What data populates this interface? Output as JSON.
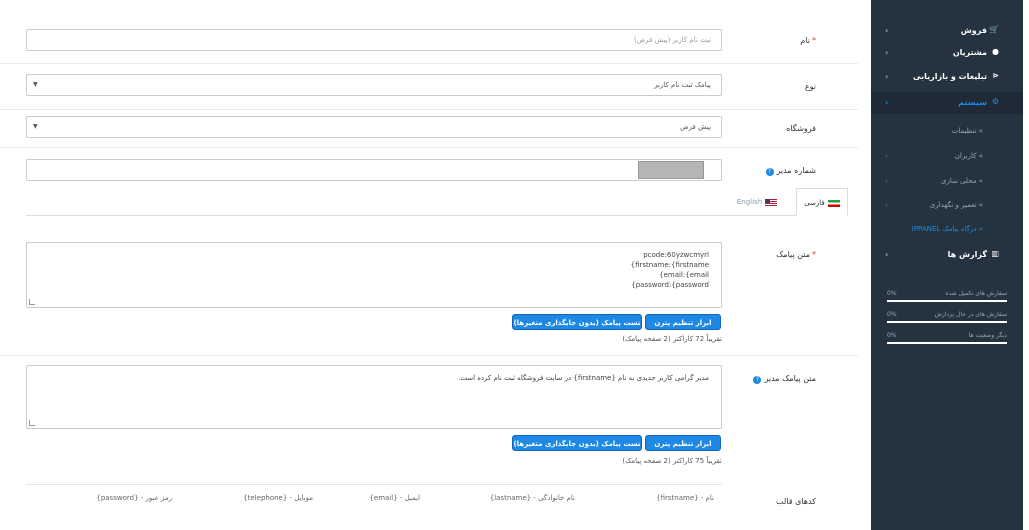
{
  "form": {
    "name": {
      "label": "نام",
      "value": "ثبت نام کاربر (پیش فرض)"
    },
    "type": {
      "label": "نوع",
      "value": "پیامک ثبت نام کاربر"
    },
    "store": {
      "label": "فروشگاه",
      "value": "پیش فرض"
    },
    "admin_number": {
      "label": "شماره مدیر"
    },
    "tabs": [
      {
        "label": "فارسی",
        "flag": "iran-flag-icon"
      },
      {
        "label": "English",
        "flag": "uk-flag-icon"
      }
    ],
    "message": {
      "label": "متن پیامک",
      "lines": [
        "pcode:60yzwcmyrl",
        "{firstname:{firstname",
        "{email:{email",
        "{password:{password"
      ],
      "btn_pattern": "ابزار تنظیم پترن",
      "btn_test": "تست پیامک (بدون جایگذاری متغیرها)",
      "count": "تقریباً 72 کاراکتر (2 صفحه پیامک)"
    },
    "admin_message": {
      "label": "متن پیامک مدیر",
      "text": "مدیر گرامی کاربر جدیدی به نام {firstname} در سایت فروشگاه ثبت نام کرده است.",
      "btn_pattern": "ابزار تنظیم پترن",
      "btn_test": "تست پیامک (بدون جایگذاری متغیرها)",
      "count": "تقریباً 75 کاراکتر (2 صفحه پیامک)"
    },
    "template_codes": {
      "label": "کدهای قالب",
      "items": [
        "نام - {firstname}",
        "نام خانوادگی - {lastname}",
        "ایمیل - {email}",
        "موبایل - {telephone}",
        "رمز عبور - {password}"
      ]
    }
  },
  "sidebar": {
    "items": [
      {
        "label": "فروش",
        "icon": "cart-icon"
      },
      {
        "label": "مشتریان",
        "icon": "user-icon"
      },
      {
        "label": "تبلیغات و بازاریابی",
        "icon": "share-icon"
      },
      {
        "label": "سیستم",
        "icon": "gear-icon"
      }
    ],
    "sub_items": [
      {
        "label": "تنظیمات"
      },
      {
        "label": "کاربران"
      },
      {
        "label": "محلی سازی"
      },
      {
        "label": "تعمیر و نگهداری"
      },
      {
        "label": "درگاه پیامک IPPANEL"
      }
    ],
    "reports": {
      "label": "گزارش ها",
      "icon": "bar-chart-icon"
    },
    "stats": [
      {
        "label": "سفارش های تکمیل شده",
        "percent": "0%"
      },
      {
        "label": "سفارش های در حال پردازش",
        "percent": "0%"
      },
      {
        "label": "دیگر وضعیت ها",
        "percent": "0%"
      }
    ]
  },
  "colors": {
    "accent": "#1e88e5",
    "sidebar_bg": "#253340",
    "sidebar_active": "#1e88e5",
    "required": "#e53935"
  }
}
